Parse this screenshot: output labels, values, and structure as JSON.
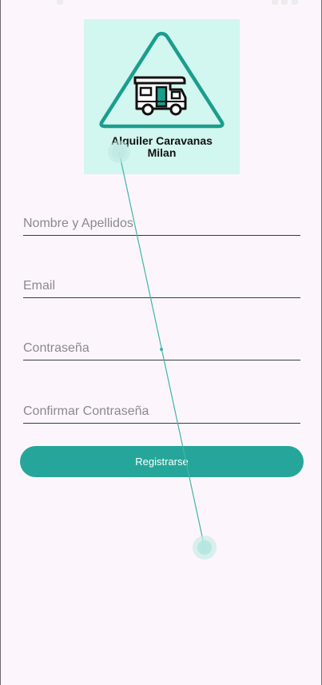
{
  "logo": {
    "line1": "Alquiler Caravanas",
    "line2": "Milan",
    "icon": "camper-van-icon",
    "background": "#d2f6f0",
    "accent": "#1a9e8c"
  },
  "form": {
    "name_placeholder": "Nombre y Apellidos",
    "email_placeholder": "Email",
    "password_placeholder": "Contraseña",
    "confirm_password_placeholder": "Confirmar Contraseña"
  },
  "actions": {
    "register_label": "Registrarse",
    "register_color": "#26a69a"
  },
  "colors": {
    "background": "#fcf6fc",
    "touch_trace": "#26a69a"
  }
}
